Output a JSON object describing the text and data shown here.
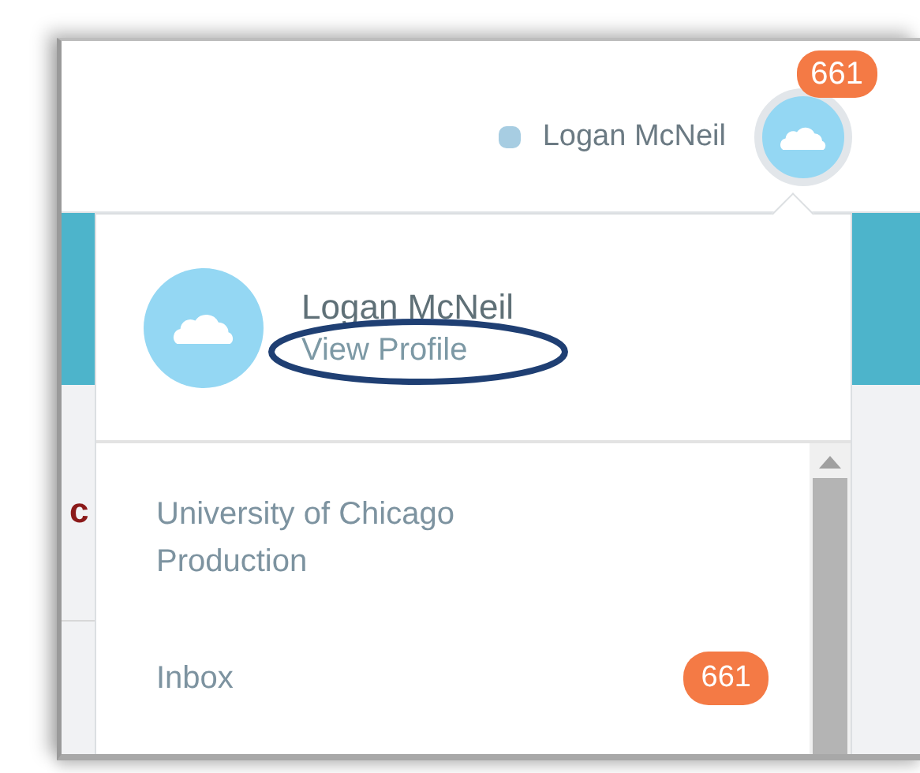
{
  "header": {
    "user_name": "Logan McNeil",
    "notification_count": "661"
  },
  "background_text": "c",
  "profile_menu": {
    "name": "Logan McNeil",
    "link": "View Profile",
    "link_circled": true,
    "items": [
      {
        "label": "University of Chicago Production"
      },
      {
        "label": "Inbox",
        "badge": "661"
      }
    ]
  }
}
